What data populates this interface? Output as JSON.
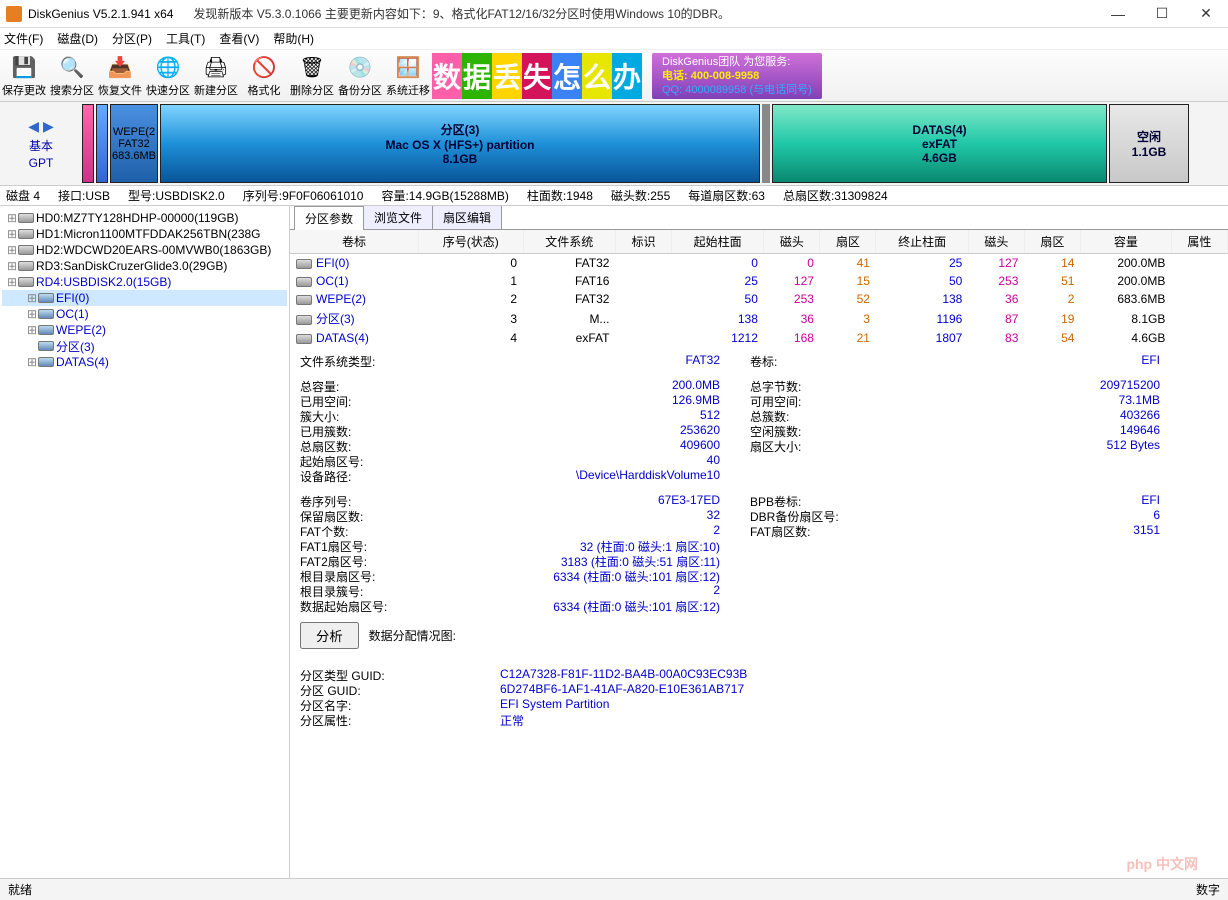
{
  "title": "DiskGenius V5.2.1.941 x64",
  "update_text": "发现新版本 V5.3.0.1066 主要更新内容如下：9、格式化FAT12/16/32分区时使用Windows 10的DBR。",
  "menu": [
    "文件(F)",
    "磁盘(D)",
    "分区(P)",
    "工具(T)",
    "查看(V)",
    "帮助(H)"
  ],
  "toolbar": [
    {
      "label": "保存更改",
      "icon": "💾"
    },
    {
      "label": "搜索分区",
      "icon": "🔍"
    },
    {
      "label": "恢复文件",
      "icon": "📥"
    },
    {
      "label": "快速分区",
      "icon": "🌐"
    },
    {
      "label": "新建分区",
      "icon": "🖨"
    },
    {
      "label": "格式化",
      "icon": "🚫"
    },
    {
      "label": "删除分区",
      "icon": "🗑"
    },
    {
      "label": "备份分区",
      "icon": "💿"
    },
    {
      "label": "系统迁移",
      "icon": "🪟"
    }
  ],
  "banner_chars": [
    "数",
    "据",
    "丢",
    "失",
    "怎",
    "么",
    "办"
  ],
  "banner_colors": [
    "#ff5ea8",
    "#2db400",
    "#ffd400",
    "#d4145a",
    "#3b82f6",
    "#e6e600",
    "#00a9e0"
  ],
  "banner2_l1": "DiskGenius团队 为您服务:",
  "banner2_l2": "电话: 400-008-9958",
  "banner2_l3": "QQ: 4000089958 (与电话同号)",
  "diskmap_left": {
    "basic": "基本",
    "gpt": "GPT"
  },
  "parts_bar": {
    "wepe": {
      "l1": "WEPE(2",
      "l2": "FAT32",
      "l3": "683.6MB"
    },
    "mac": {
      "l1": "分区(3)",
      "l2": "Mac OS X (HFS+) partition",
      "l3": "8.1GB"
    },
    "datas": {
      "l1": "DATAS(4)",
      "l2": "exFAT",
      "l3": "4.6GB"
    },
    "free": {
      "l1": "空闲",
      "l2": "1.1GB"
    }
  },
  "infoline_items": [
    "磁盘 4",
    "接口:USB",
    "型号:USBDISK2.0",
    "序列号:9F0F06061010",
    "容量:14.9GB(15288MB)",
    "柱面数:1948",
    "磁头数:255",
    "每道扇区数:63",
    "总扇区数:31309824"
  ],
  "tree": [
    {
      "indent": 0,
      "exp": "+",
      "icon": "disk",
      "text": "HD0:MZ7TY128HDHP-00000(119GB)"
    },
    {
      "indent": 0,
      "exp": "+",
      "icon": "disk",
      "text": "HD1:Micron1100MTFDDAK256TBN(238G"
    },
    {
      "indent": 0,
      "exp": "+",
      "icon": "disk",
      "text": "HD2:WDCWD20EARS-00MVWB0(1863GB)"
    },
    {
      "indent": 0,
      "exp": "+",
      "icon": "disk",
      "text": "RD3:SanDiskCruzerGlide3.0(29GB)"
    },
    {
      "indent": 0,
      "exp": "-",
      "icon": "disk",
      "text": "RD4:USBDISK2.0(15GB)",
      "blue": true
    },
    {
      "indent": 1,
      "exp": "+",
      "icon": "vol",
      "text": "EFI(0)",
      "sel": true,
      "blue": true
    },
    {
      "indent": 1,
      "exp": "+",
      "icon": "vol",
      "text": "OC(1)",
      "blue": true
    },
    {
      "indent": 1,
      "exp": "+",
      "icon": "vol",
      "text": "WEPE(2)",
      "blue": true
    },
    {
      "indent": 1,
      "exp": "",
      "icon": "vol",
      "text": "分区(3)",
      "blue": true
    },
    {
      "indent": 1,
      "exp": "+",
      "icon": "vol",
      "text": "DATAS(4)",
      "blue": true
    }
  ],
  "tabs": [
    "分区参数",
    "浏览文件",
    "扇区编辑"
  ],
  "ptable_head": [
    "卷标",
    "序号(状态)",
    "文件系统",
    "标识",
    "起始柱面",
    "磁头",
    "扇区",
    "终止柱面",
    "磁头",
    "扇区",
    "容量",
    "属性"
  ],
  "ptable_rows": [
    {
      "name": "EFI(0)",
      "seq": "0",
      "fs": "FAT32",
      "mark": "",
      "sc": "0",
      "sh": "0",
      "ss": "41",
      "ec": "25",
      "eh": "127",
      "es": "14",
      "cap": "200.0MB",
      "attr": ""
    },
    {
      "name": "OC(1)",
      "seq": "1",
      "fs": "FAT16",
      "mark": "",
      "sc": "25",
      "sh": "127",
      "ss": "15",
      "ec": "50",
      "eh": "253",
      "es": "51",
      "cap": "200.0MB",
      "attr": ""
    },
    {
      "name": "WEPE(2)",
      "seq": "2",
      "fs": "FAT32",
      "mark": "",
      "sc": "50",
      "sh": "253",
      "ss": "52",
      "ec": "138",
      "eh": "36",
      "es": "2",
      "cap": "683.6MB",
      "attr": ""
    },
    {
      "name": "分区(3)",
      "seq": "3",
      "fs": "M...",
      "mark": "",
      "sc": "138",
      "sh": "36",
      "ss": "3",
      "ec": "1196",
      "eh": "87",
      "es": "19",
      "cap": "8.1GB",
      "attr": ""
    },
    {
      "name": "DATAS(4)",
      "seq": "4",
      "fs": "exFAT",
      "mark": "",
      "sc": "1212",
      "sh": "168",
      "ss": "21",
      "ec": "1807",
      "eh": "83",
      "es": "54",
      "cap": "4.6GB",
      "attr": ""
    }
  ],
  "props": {
    "fs_type_lbl": "文件系统类型:",
    "fs_type_val": "FAT32",
    "vol_lbl": "卷标:",
    "vol_val": "EFI",
    "rows1": [
      [
        "总容量:",
        "200.0MB",
        "总字节数:",
        "209715200"
      ],
      [
        "已用空间:",
        "126.9MB",
        "可用空间:",
        "73.1MB"
      ],
      [
        "簇大小:",
        "512",
        "总簇数:",
        "403266"
      ],
      [
        "已用簇数:",
        "253620",
        "空闲簇数:",
        "149646"
      ],
      [
        "总扇区数:",
        "409600",
        "扇区大小:",
        "512 Bytes"
      ],
      [
        "起始扇区号:",
        "40",
        "",
        ""
      ],
      [
        "设备路径:",
        "\\Device\\HarddiskVolume10",
        "",
        ""
      ]
    ],
    "rows2": [
      [
        "卷序列号:",
        "67E3-17ED",
        "BPB卷标:",
        "EFI"
      ],
      [
        "保留扇区数:",
        "32",
        "DBR备份扇区号:",
        "6"
      ],
      [
        "FAT个数:",
        "2",
        "FAT扇区数:",
        "3151"
      ],
      [
        "FAT1扇区号:",
        "32 (柱面:0 磁头:1 扇区:10)",
        "",
        ""
      ],
      [
        "FAT2扇区号:",
        "3183 (柱面:0 磁头:51 扇区:11)",
        "",
        ""
      ],
      [
        "根目录扇区号:",
        "6334 (柱面:0 磁头:101 扇区:12)",
        "",
        ""
      ],
      [
        "根目录簇号:",
        "2",
        "",
        ""
      ],
      [
        "数据起始扇区号:",
        "6334 (柱面:0 磁头:101 扇区:12)",
        "",
        ""
      ]
    ],
    "analyze_btn": "分析",
    "alloc_lbl": "数据分配情况图:",
    "rows3": [
      [
        "分区类型 GUID:",
        "C12A7328-F81F-11D2-BA4B-00A0C93EC93B"
      ],
      [
        "分区 GUID:",
        "6D274BF6-1AF1-41AF-A820-E10E361AB717"
      ],
      [
        "分区名字:",
        "EFI System Partition"
      ],
      [
        "分区属性:",
        "正常"
      ]
    ]
  },
  "statusbar": {
    "left": "就绪",
    "right": [
      "数字"
    ]
  },
  "watermark": "php 中文网"
}
